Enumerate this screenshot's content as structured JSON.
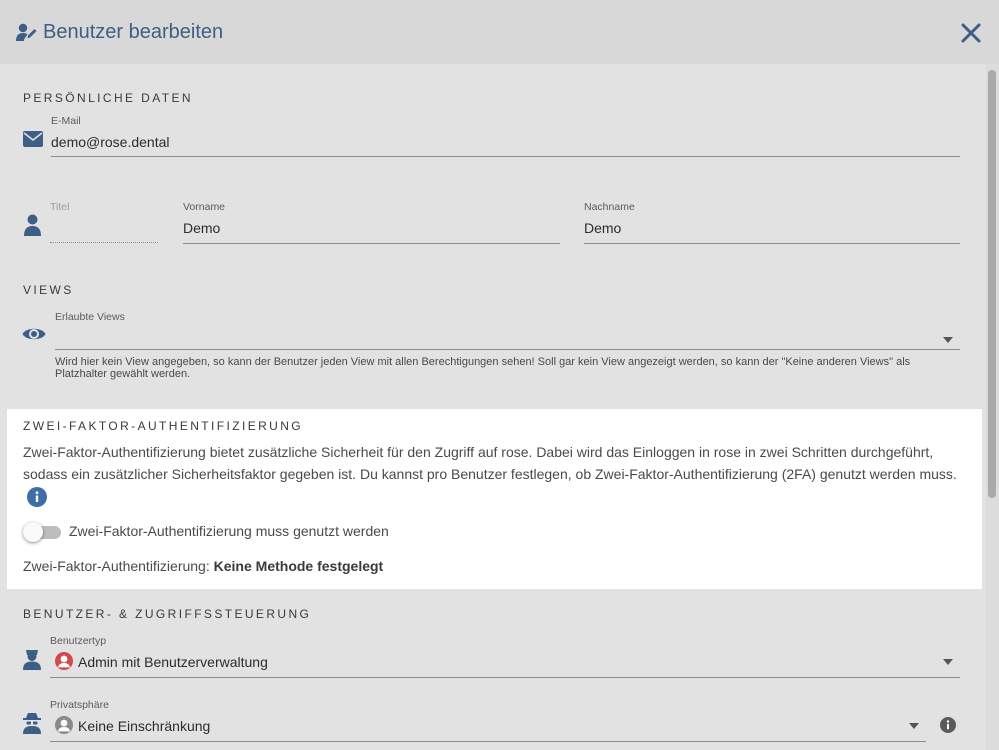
{
  "header": {
    "title": "Benutzer bearbeiten"
  },
  "personal": {
    "section_title": "PERSÖNLICHE DATEN",
    "email_label": "E-Mail",
    "email_value": "demo@rose.dental",
    "titel_label": "Titel",
    "titel_value": "",
    "vorname_label": "Vorname",
    "vorname_value": "Demo",
    "nachname_label": "Nachname",
    "nachname_value": "Demo"
  },
  "views": {
    "section_title": "VIEWS",
    "field_label": "Erlaubte Views",
    "field_value": "",
    "help": "Wird hier kein View angegeben, so kann der Benutzer jeden View mit allen Berechtigungen sehen! Soll gar kein View angezeigt werden, so kann der \"Keine anderen Views\" als Platzhalter gewählt werden."
  },
  "twofa": {
    "section_title": "ZWEI-FAKTOR-AUTHENTIFIZIERUNG",
    "description": "Zwei-Faktor-Authentifizierung bietet zusätzliche Sicherheit für den Zugriff auf rose. Dabei wird das Einloggen in rose in zwei Schritten durchgeführt, sodass ein zusätzlicher Sicherheitsfaktor gegeben ist. Du kannst pro Benutzer festlegen, ob Zwei-Faktor-Authentifizierung (2FA) genutzt werden muss.",
    "toggle_label": "Zwei-Faktor-Authentifizierung muss genutzt werden",
    "toggle_on": false,
    "method_prefix": "Zwei-Faktor-Authentifizierung: ",
    "method_value": "Keine Methode festgelegt"
  },
  "access": {
    "section_title": "BENUTZER- & ZUGRIFFSSTEUERUNG",
    "benutzertyp_label": "Benutzertyp",
    "benutzertyp_value": "Admin mit Benutzerverwaltung",
    "privat_label": "Privatsphäre",
    "privat_value": "Keine Einschränkung"
  },
  "colors": {
    "accent": "#3d5e85",
    "admin_avatar": "#d24b4b",
    "neutral_avatar": "#8a8a8a"
  },
  "icons": [
    "user-edit-icon",
    "close-icon",
    "envelope-icon",
    "person-icon",
    "eye-icon",
    "info-icon",
    "user-tie-icon",
    "user-secret-icon",
    "chevron-down-icon"
  ]
}
